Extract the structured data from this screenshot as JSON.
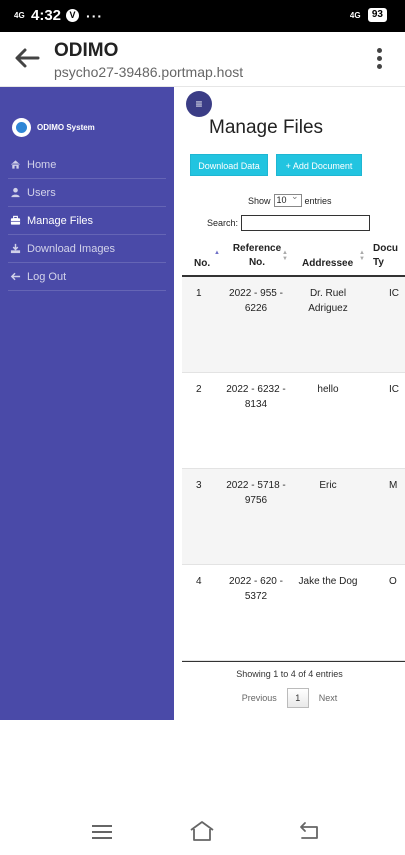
{
  "status_bar": {
    "network": "4G",
    "time": "4:32",
    "vpn_icon": "v-shield-icon",
    "more": "···",
    "signal_label": "4G",
    "battery": "93"
  },
  "browser": {
    "title": "ODIMO",
    "url": "psycho27-39486.portmap.host"
  },
  "sidebar": {
    "brand": "ODIMO System",
    "items": [
      {
        "label": "Home",
        "icon": "home-icon"
      },
      {
        "label": "Users",
        "icon": "user-icon"
      },
      {
        "label": "Manage Files",
        "icon": "briefcase-icon"
      },
      {
        "label": "Download Images",
        "icon": "download-icon"
      },
      {
        "label": "Log Out",
        "icon": "arrow-left-icon"
      }
    ],
    "active": "Manage Files",
    "background_color": "#4a4aa8"
  },
  "main": {
    "toggle_label": "≡",
    "title": "Manage Files",
    "download_button": "Download Data",
    "add_button": "+ Add Document",
    "accent_color": "#22c4e0",
    "show_label": "Show",
    "show_value": "10",
    "entries_label": "entries",
    "search_label": "Search:",
    "search_value": ""
  },
  "table": {
    "headers": {
      "no": "No.",
      "ref_line1": "Reference",
      "ref_line2": "No.",
      "addressee": "Addressee",
      "doc_line1": "Docu",
      "doc_line2": "Ty"
    },
    "rows": [
      {
        "no": "1",
        "ref": "2022 - 955 - 6226",
        "addressee": "Dr. Ruel Adriguez",
        "doc": "IC"
      },
      {
        "no": "2",
        "ref": "2022 - 6232 - 8134",
        "addressee": "hello",
        "doc": "IC"
      },
      {
        "no": "3",
        "ref": "2022 - 5718 - 9756",
        "addressee": "Eric",
        "doc": "M"
      },
      {
        "no": "4",
        "ref": "2022 - 620 - 5372",
        "addressee": "Jake the Dog",
        "doc": "O"
      }
    ],
    "info": "Showing 1 to 4 of 4 entries",
    "previous": "Previous",
    "page": "1",
    "next": "Next"
  }
}
